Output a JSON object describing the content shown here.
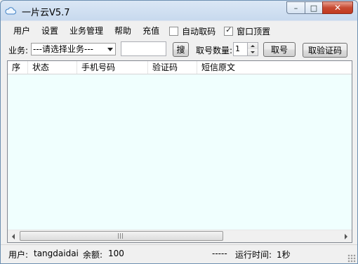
{
  "window": {
    "title": "一片云V5.7",
    "controls": {
      "minimize": "–",
      "maximize": "□",
      "close": "✕"
    }
  },
  "menu": {
    "items": [
      "用户",
      "设置",
      "业务管理",
      "帮助",
      "充值"
    ],
    "checkboxes": [
      {
        "label": "自动取码",
        "checked": false
      },
      {
        "label": "窗口顶置",
        "checked": true
      }
    ]
  },
  "toolbar": {
    "business_label": "业务:",
    "business_select": "---请选择业务---",
    "search_input": "",
    "search_button": "搜",
    "quantity_label": "取号数量:",
    "quantity_value": "1",
    "get_number_button": "取号",
    "get_code_button": "取验证码"
  },
  "table": {
    "columns": [
      "序",
      "状态",
      "手机号码",
      "验证码",
      "短信原文"
    ],
    "rows": [],
    "background": "#f0fffe"
  },
  "statusbar": {
    "user_label": "用户:",
    "username": "tangdaidai",
    "balance_label": "余额:",
    "balance": "100",
    "dashes": "-----",
    "runtime_label": "运行时间:",
    "runtime": "1秒"
  }
}
